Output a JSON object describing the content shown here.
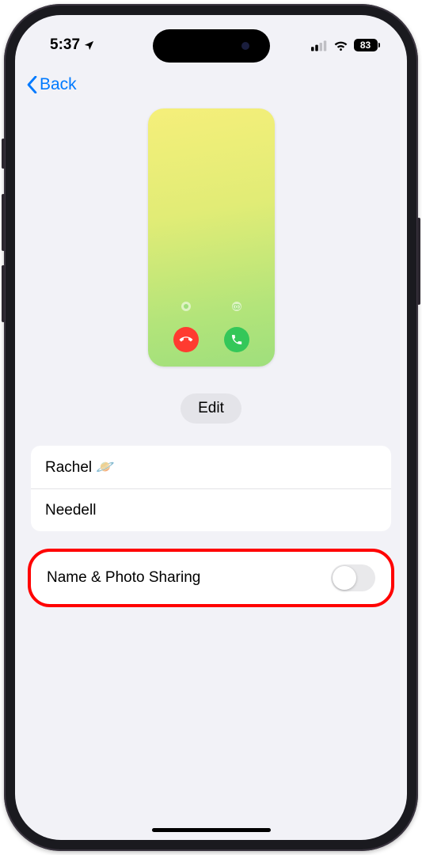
{
  "status": {
    "time": "5:37",
    "battery": "83"
  },
  "nav": {
    "back_label": "Back"
  },
  "edit": {
    "label": "Edit"
  },
  "name": {
    "first": "Rachel 🪐",
    "last": "Needell"
  },
  "sharing": {
    "label": "Name & Photo Sharing",
    "enabled": false
  }
}
